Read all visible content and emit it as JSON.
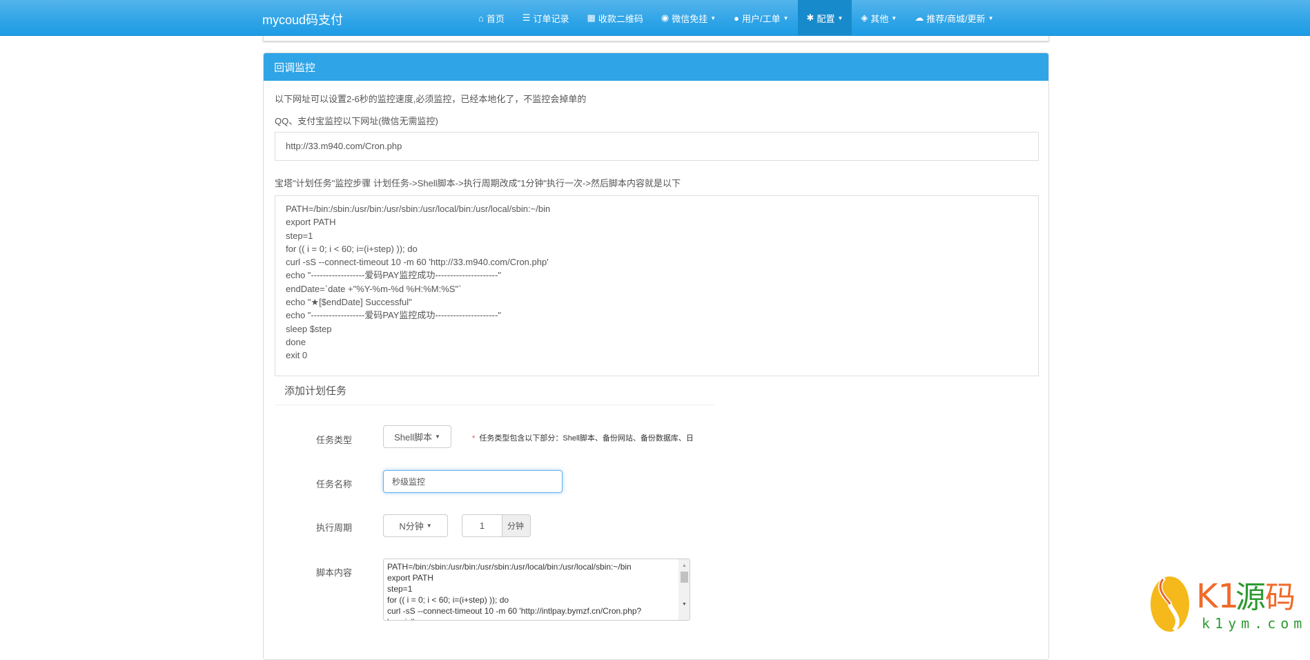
{
  "nav": {
    "brand": "mycoud码支付",
    "items": [
      {
        "icon": "home-icon",
        "label": "首页",
        "caret": false
      },
      {
        "icon": "list-icon",
        "label": "订单记录",
        "caret": false
      },
      {
        "icon": "qrcode-icon",
        "label": "收款二维码",
        "caret": false
      },
      {
        "icon": "wechat-icon",
        "label": "微信免挂",
        "caret": true
      },
      {
        "icon": "user-icon",
        "label": "用户/工单",
        "caret": true
      },
      {
        "icon": "gear-icon",
        "label": "配置",
        "caret": true,
        "active": true
      },
      {
        "icon": "cube-icon",
        "label": "其他",
        "caret": true
      },
      {
        "icon": "cloud-icon",
        "label": "推荐/商城/更新",
        "caret": true
      }
    ]
  },
  "panel": {
    "title": "回调监控",
    "line1": "以下网址可以设置2-6秒的监控速度,必须监控，已经本地化了，不监控会掉单的",
    "line2": "QQ、支付宝监控以下网址(微信无需监控)",
    "url": "http://33.m940.com/Cron.php",
    "line3": "宝塔\"计划任务\"监控步骤 计划任务->Shell脚本->执行周期改成\"1分钟\"执行一次->然后脚本内容就是以下",
    "code": [
      "PATH=/bin:/sbin:/usr/bin:/usr/sbin:/usr/local/bin:/usr/local/sbin:~/bin",
      "export PATH",
      "step=1",
      "for (( i = 0; i < 60; i=(i+step) )); do",
      "curl -sS --connect-timeout 10 -m 60 'http://33.m940.com/Cron.php'",
      "echo \"------------------爱码PAY监控成功---------------------\"",
      "endDate=`date +\"%Y-%m-%d %H:%M:%S\"`",
      "echo \"★[$endDate] Successful\"",
      "echo \"------------------爱码PAY监控成功---------------------\"",
      "sleep $step",
      "done",
      "exit 0"
    ]
  },
  "form": {
    "heading": "添加计划任务",
    "type_label": "任务类型",
    "type_value": "Shell脚本",
    "type_hint_star": "*",
    "type_hint": "任务类型包含以下部分：Shell脚本、备份网站、备份数据库、日",
    "name_label": "任务名称",
    "name_value": "秒级监控",
    "period_label": "执行周期",
    "period_value": "N分钟",
    "minutes_value": "1",
    "minutes_unit": "分钟",
    "script_label": "脚本内容",
    "script_value": "PATH=/bin:/sbin:/usr/bin:/usr/sbin:/usr/local/bin:/usr/local/sbin:~/bin\nexport PATH\nstep=1\nfor (( i = 0; i < 60; i=(i+step) )); do\ncurl -sS --connect-timeout 10 -m 60 'http://intlpay.bymzf.cn/Cron.php?\nkey=ixl'"
  },
  "watermark": {
    "title": "K1源码",
    "domain": "k1ym.com"
  }
}
